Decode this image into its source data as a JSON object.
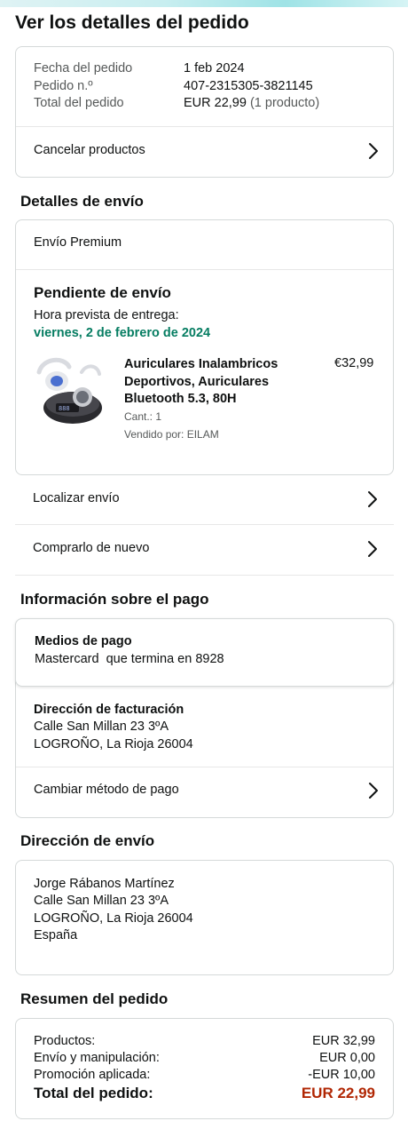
{
  "page_title": "Ver los detalles del pedido",
  "order_info": {
    "date_label": "Fecha del pedido",
    "date_value": "1 feb 2024",
    "order_label": "Pedido n.º",
    "order_value": "407-2315305-3821145",
    "total_label": "Total del pedido",
    "total_value": "EUR 22,99",
    "total_count": "(1 producto)",
    "cancel_label": "Cancelar productos"
  },
  "shipping_details": {
    "section_title": "Detalles de envío",
    "service": "Envío Premium",
    "status": "Pendiente de envío",
    "eta_label": "Hora prevista de entrega:",
    "eta_value": "viernes, 2 de febrero de 2024",
    "item": {
      "title": "Auriculares Inalambricos Deportivos, Auriculares Bluetooth 5.3, 80H",
      "price": "€32,99",
      "qty": "Cant.: 1",
      "seller": "Vendido por: EILAM"
    },
    "track_label": "Localizar envío",
    "buy_again_label": "Comprarlo de nuevo"
  },
  "payment": {
    "section_title": "Información sobre el pago",
    "method_title": "Medios de pago",
    "method_value": "Mastercard  que termina en 8928",
    "billing_title": "Dirección de facturación",
    "billing_line1": "Calle San Millan 23 3ºA",
    "billing_line2": "LOGROÑO, La Rioja 26004",
    "change_label": "Cambiar método de pago"
  },
  "delivery_address": {
    "section_title": "Dirección de envío",
    "name": "Jorge Rábanos Martínez",
    "line1": "Calle San Millan 23 3ºA",
    "line2": "LOGROÑO, La Rioja 26004",
    "country": "España"
  },
  "summary": {
    "section_title": "Resumen del pedido",
    "products_label": "Productos:",
    "products_value": "EUR 32,99",
    "shipping_label": "Envío y manipulación:",
    "shipping_value": "EUR 0,00",
    "promo_label": "Promoción aplicada:",
    "promo_value": "-EUR 10,00",
    "total_label": "Total del pedido:",
    "total_value": "EUR 22,99"
  },
  "colors": {
    "green": "#067d62",
    "total_red": "#b12704",
    "border": "#d5d9d9"
  },
  "icons": [
    "chevron-right-icon",
    "earbuds-product-image"
  ]
}
